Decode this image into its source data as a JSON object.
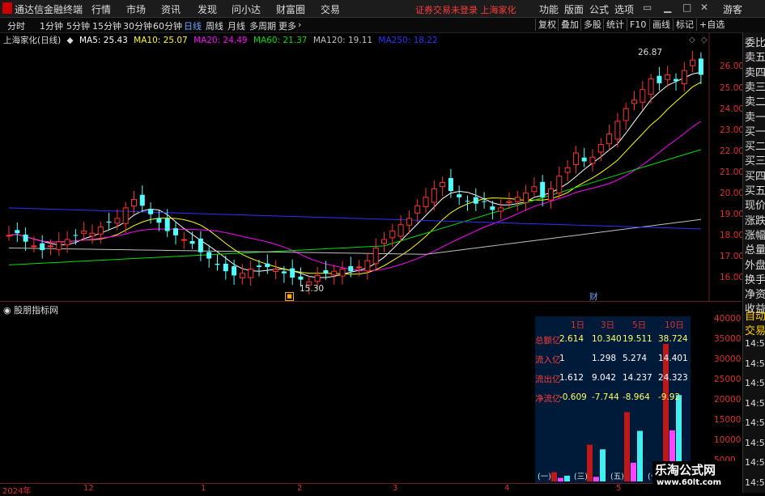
{
  "app": {
    "title": "通达信金融终端"
  },
  "menu": {
    "items": [
      "行情",
      "市场",
      "资讯",
      "发现",
      "问小达",
      "财富圈",
      "交易"
    ],
    "hint": "证券交易未登录  上海家化",
    "right_items": [
      "功能",
      "版面",
      "公式",
      "选项"
    ],
    "user": "游客"
  },
  "periods": {
    "items": [
      "分时",
      "1分钟",
      "5分钟",
      "15分钟",
      "30分钟",
      "60分钟",
      "日线",
      "周线",
      "月线",
      "多周期",
      "更多"
    ],
    "active": "日线"
  },
  "toolbar": {
    "items": [
      "复权",
      "叠加",
      "多股",
      "统计",
      "F10",
      "画线",
      "标记",
      "+自选"
    ]
  },
  "stock": {
    "title": "上海家化(日线)"
  },
  "ma": {
    "ma5": "MA5: 25.43",
    "ma10": "MA10: 25.07",
    "ma20": "MA20: 24.49",
    "ma60": "MA60: 21.37",
    "ma120": "MA120: 19.11",
    "ma250": "MA250: 18.22"
  },
  "price_axis": [
    "26.00",
    "25.00",
    "24.00",
    "23.00",
    "22.00",
    "21.00",
    "20.00",
    "19.00",
    "18.00",
    "17.00",
    "16.00"
  ],
  "annotations": {
    "high": "26.87",
    "low": "15.30",
    "cai": "财"
  },
  "side_tabs": [
    "委比",
    "卖五",
    "卖四",
    "卖三",
    "卖二",
    "卖一",
    "买一",
    "买二",
    "买三",
    "买四",
    "买五",
    "现价",
    "涨跌",
    "涨幅",
    "总量",
    "外盘",
    "换手",
    "净资",
    "收益",
    "自动",
    "交易"
  ],
  "indicator": {
    "title": "股朋指标网",
    "scale": [
      "40000",
      "35000",
      "30000",
      "25000",
      "20000",
      "15000",
      "10000",
      "5000"
    ],
    "times": [
      "14:56",
      "14:56",
      "14:56",
      "14:56",
      "14:56",
      "14:56",
      "14:56",
      "14:56"
    ]
  },
  "flow_table": {
    "headers": [
      "1日",
      "3日",
      "5日",
      "10日"
    ],
    "rows": [
      {
        "label": "总额亿",
        "values": [
          "2.614",
          "10.340",
          "19.511",
          "38.724"
        ]
      },
      {
        "label": "流入亿",
        "values": [
          "1",
          "1.298",
          "5.274",
          "14.401"
        ]
      },
      {
        "label": "流出亿",
        "values": [
          "1.612",
          "9.042",
          "14.237",
          "24.323"
        ]
      },
      {
        "label": "净流亿",
        "values": [
          "-0.609",
          "-7.744",
          "-8.964",
          "-9.92"
        ]
      }
    ],
    "groups": [
      "(一)",
      "(三)",
      "(五)",
      "(十)"
    ],
    "bars": [
      {
        "in": 1,
        "out": 1.612,
        "total": 2.614
      },
      {
        "in": 1.298,
        "out": 9.042,
        "total": 10.34
      },
      {
        "in": 5.274,
        "out": 14.237,
        "total": 19.511
      },
      {
        "in": 14.401,
        "out": 24.323,
        "total": 38.724
      }
    ]
  },
  "time_axis": [
    "2024年",
    "12",
    "1",
    "2",
    "3",
    "4",
    "5"
  ],
  "watermark": {
    "title": "乐淘公式网",
    "url": "www.60lt.com"
  },
  "colors": {
    "up": "#ff3232",
    "down": "#54ffff",
    "ma5": "#ffffff",
    "ma10": "#ffff00",
    "ma20": "#ff00ff",
    "ma60": "#00e000",
    "ma120": "#c0c0c0",
    "ma250": "#3030ff"
  }
}
